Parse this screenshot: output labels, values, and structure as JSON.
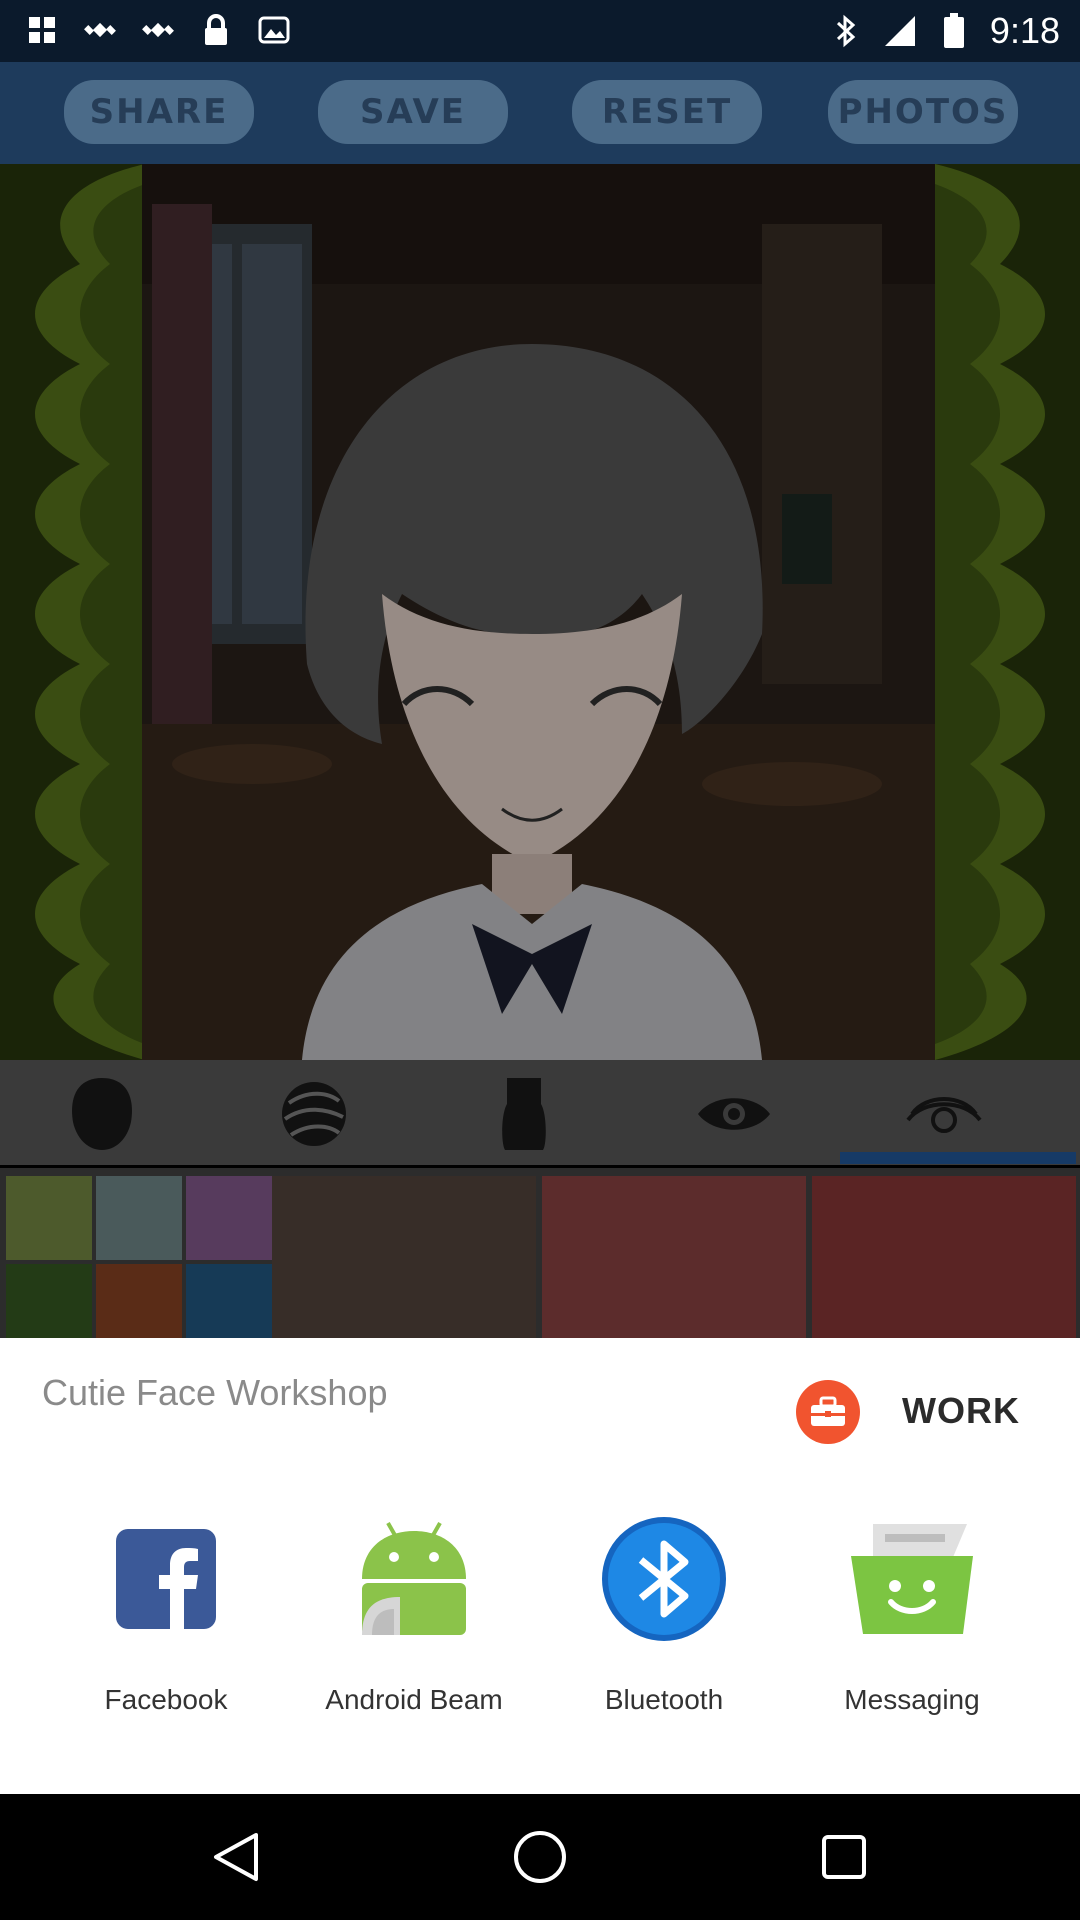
{
  "status_bar": {
    "time": "9:18",
    "left_icons": [
      "grid-icon",
      "satellite-icon",
      "satellite-icon",
      "lock-icon",
      "photo-icon"
    ],
    "right_icons": [
      "bluetooth-icon",
      "signal-icon",
      "battery-icon"
    ]
  },
  "toolbar": {
    "share_label": "SHARE",
    "save_label": "SAVE",
    "reset_label": "RESET",
    "photos_label": "PHOTOS"
  },
  "categories": [
    "head-icon",
    "hair-icon",
    "neck-icon",
    "eye-icon",
    "eye-icon"
  ],
  "swatches": {
    "small": [
      "#4d5a2c",
      "#4a5a5b",
      "#573b5d",
      "#233b16",
      "#5a2c17",
      "#163a56"
    ],
    "large": [
      "#372d28",
      "#5c2c2c",
      "#5a2424"
    ]
  },
  "share_sheet": {
    "title": "Cutie Face Workshop",
    "profile_label": "WORK",
    "apps": [
      {
        "label": "Facebook",
        "icon": "facebook-icon"
      },
      {
        "label": "Android Beam",
        "icon": "android-icon"
      },
      {
        "label": "Bluetooth",
        "icon": "bluetooth-icon"
      },
      {
        "label": "Messaging",
        "icon": "messaging-icon"
      }
    ]
  },
  "colors": {
    "work_accent": "#f1542f",
    "facebook_blue": "#3b5998",
    "android_green": "#8bc34a",
    "bluetooth_blue": "#1565c0",
    "messaging_green": "#7cc542"
  }
}
